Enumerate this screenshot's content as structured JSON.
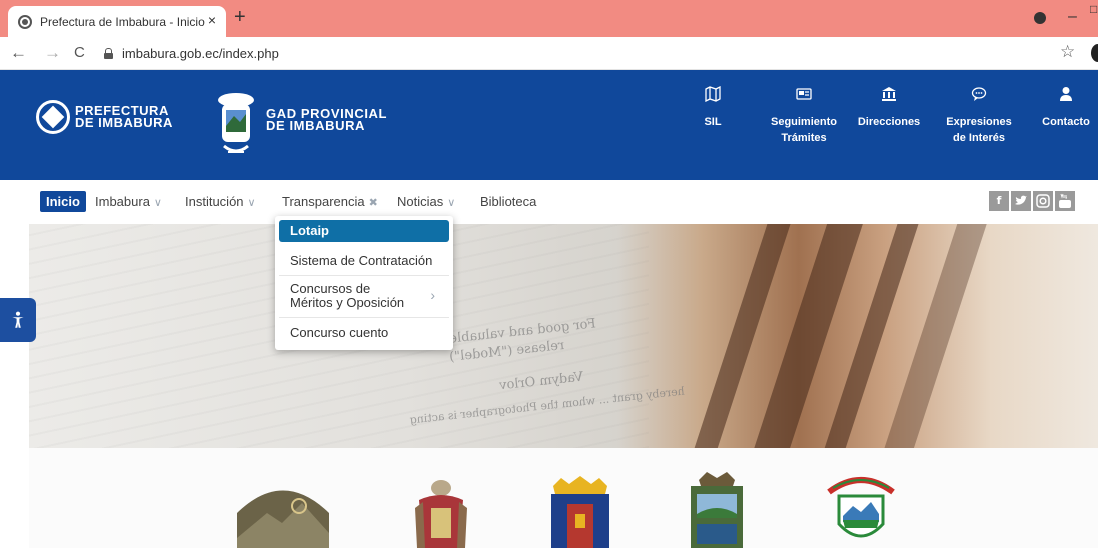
{
  "browser": {
    "tab_title": "Prefectura de Imbabura - Inicio",
    "tab_close": "×",
    "new_tab": "+",
    "url": "imbabura.gob.ec/index.php",
    "back": "←",
    "forward": "→",
    "reload": "C",
    "star": "☆",
    "minimize": "–",
    "window_extra": "□"
  },
  "header": {
    "logo_line1": "PREFECTURA",
    "logo_line2": "DE IMBABURA",
    "gad_line1": "GAD PROVINCIAL",
    "gad_line2": "DE IMBABURA",
    "top_nav": [
      {
        "label": "SIL",
        "icon": "map-icon"
      },
      {
        "label": "Seguimiento Trámites",
        "icon": "id-card-icon"
      },
      {
        "label": "Direcciones",
        "icon": "institution-icon"
      },
      {
        "label": "Expresiones de Interés",
        "icon": "chat-bubble-icon"
      },
      {
        "label": "Contacto",
        "icon": "user-icon"
      }
    ]
  },
  "main_nav": {
    "items": [
      {
        "label": "Inicio"
      },
      {
        "label": "Imbabura"
      },
      {
        "label": "Institución"
      },
      {
        "label": "Transparencia"
      },
      {
        "label": "Noticias"
      },
      {
        "label": "Biblioteca"
      }
    ],
    "social": [
      "f",
      "twitter-icon",
      "instagram-icon",
      "youtube-icon"
    ]
  },
  "dropdown": {
    "items": [
      {
        "label": "Lotaip",
        "active": true
      },
      {
        "label": "Sistema de Contratación"
      },
      {
        "label": "Concursos de Méritos y Oposición",
        "has_submenu": true
      },
      {
        "label": "Concurso cuento"
      }
    ]
  },
  "hero": {
    "text_lines": [
      "For good and valuable",
      "release (\"Model\")",
      "Vadym Orlov",
      "hereby grant ... whom the Photographer is acting"
    ]
  },
  "colors": {
    "header_blue": "#10489b",
    "tab_bar": "#f28b82",
    "dropdown_active": "#0f6fa6",
    "social_gray": "#9a9a9a"
  }
}
